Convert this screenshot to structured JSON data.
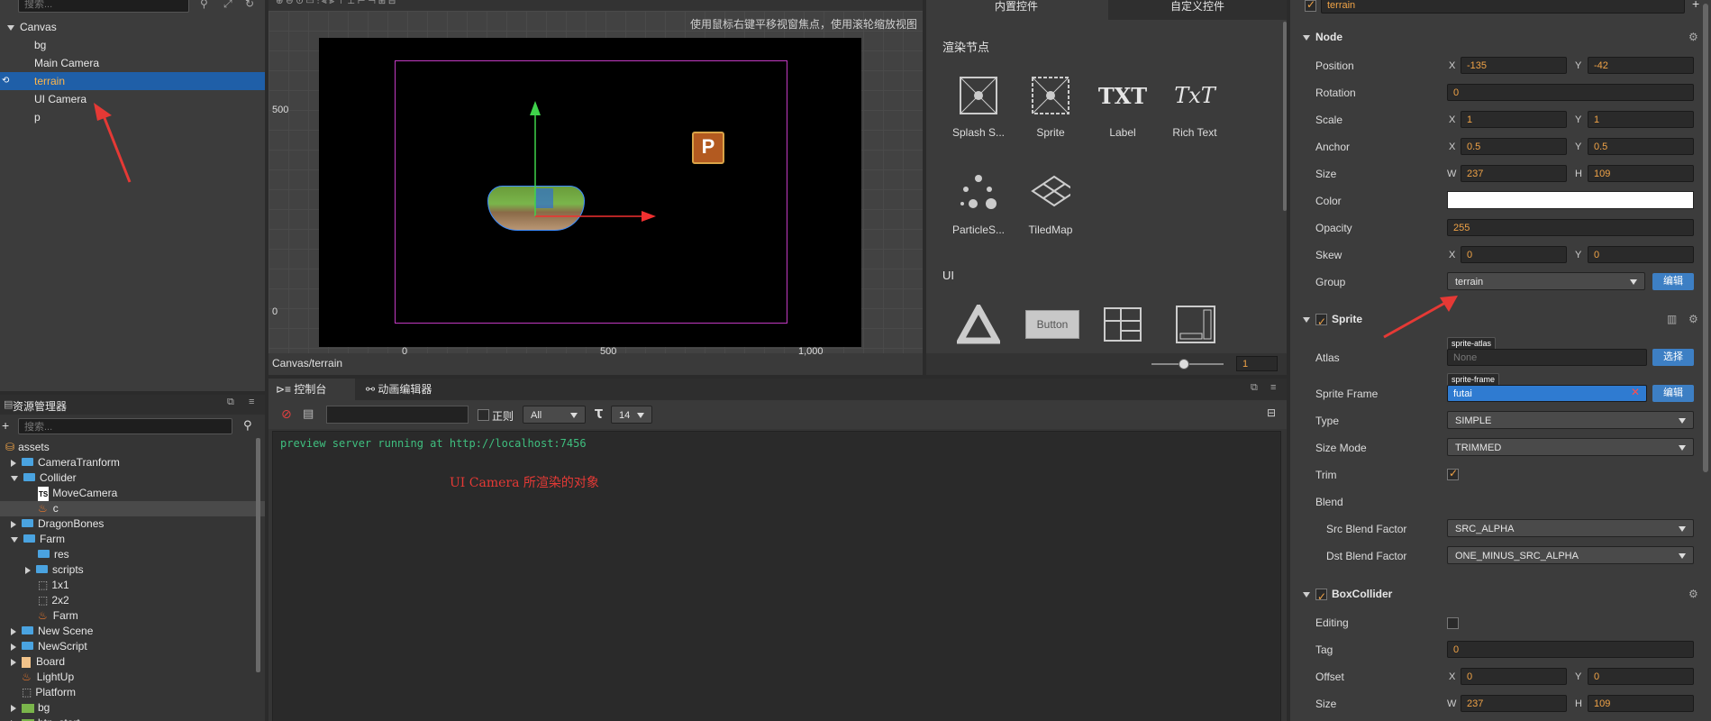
{
  "hierarchy": {
    "search_placeholder": "搜索...",
    "root": "Canvas",
    "items": [
      {
        "label": "bg"
      },
      {
        "label": "Main Camera"
      },
      {
        "label": "terrain"
      },
      {
        "label": "UI Camera"
      },
      {
        "label": "p"
      }
    ]
  },
  "scene": {
    "hint": "使用鼠标右键平移视窗焦点，使用滚轮缩放视图",
    "ruler_y": [
      "500",
      "0"
    ],
    "ruler_x": [
      "0",
      "500",
      "1,000"
    ],
    "breadcrumb": "Canvas/terrain",
    "zoom_value": "1"
  },
  "nodelib": {
    "tabs": [
      "内置控件",
      "自定义控件"
    ],
    "section_render": "渲染节点",
    "render_items": [
      {
        "label": "Splash S...",
        "icon": "splash-icon"
      },
      {
        "label": "Sprite",
        "icon": "sprite-icon"
      },
      {
        "label": "Label",
        "icon": "label-icon",
        "glyph": "TXT"
      },
      {
        "label": "Rich Text",
        "icon": "richtext-icon",
        "glyph": "TxT"
      },
      {
        "label": "ParticleS...",
        "icon": "particle-icon"
      },
      {
        "label": "TiledMap",
        "icon": "tiledmap-icon"
      }
    ],
    "section_ui": "UI",
    "ui_button_label": "Button"
  },
  "assets": {
    "title": "资源管理器",
    "search_placeholder": "搜索...",
    "items": [
      {
        "label": "assets"
      },
      {
        "label": "CameraTranform"
      },
      {
        "label": "Collider"
      },
      {
        "label": "MoveCamera"
      },
      {
        "label": "c"
      },
      {
        "label": "DragonBones"
      },
      {
        "label": "Farm"
      },
      {
        "label": "res"
      },
      {
        "label": "scripts"
      },
      {
        "label": "1x1"
      },
      {
        "label": "2x2"
      },
      {
        "label": "Farm"
      },
      {
        "label": "New Scene"
      },
      {
        "label": "NewScript"
      },
      {
        "label": "Board"
      },
      {
        "label": "LightUp"
      },
      {
        "label": "Platform"
      },
      {
        "label": "bg"
      },
      {
        "label": "btn_start"
      }
    ]
  },
  "console": {
    "tabs": [
      "控制台",
      "动画编辑器"
    ],
    "regex_label": "正则",
    "level_select": "All",
    "font_size": "14",
    "log_line": "preview server running at http://localhost:7456",
    "annotation": "UI Camera 所渲染的对象"
  },
  "inspector": {
    "node_name": "terrain",
    "node_section": "Node",
    "position": {
      "label": "Position",
      "x": "-135",
      "y": "-42"
    },
    "rotation": {
      "label": "Rotation",
      "value": "0"
    },
    "scale": {
      "label": "Scale",
      "x": "1",
      "y": "1"
    },
    "anchor": {
      "label": "Anchor",
      "x": "0.5",
      "y": "0.5"
    },
    "size": {
      "label": "Size",
      "w": "237",
      "h": "109"
    },
    "color": {
      "label": "Color",
      "value": "#ffffff"
    },
    "opacity": {
      "label": "Opacity",
      "value": "255"
    },
    "skew": {
      "label": "Skew",
      "x": "0",
      "y": "0"
    },
    "group": {
      "label": "Group",
      "value": "terrain",
      "edit": "编辑"
    },
    "sprite_section": "Sprite",
    "atlas": {
      "label": "Atlas",
      "tag": "sprite-atlas",
      "placeholder": "None",
      "btn": "选择"
    },
    "sprite_frame": {
      "label": "Sprite Frame",
      "tag": "sprite-frame",
      "value": "futai",
      "btn": "编辑"
    },
    "type": {
      "label": "Type",
      "value": "SIMPLE"
    },
    "size_mode": {
      "label": "Size Mode",
      "value": "TRIMMED"
    },
    "trim": {
      "label": "Trim"
    },
    "blend": {
      "label": "Blend"
    },
    "src_blend": {
      "label": "Src Blend Factor",
      "value": "SRC_ALPHA"
    },
    "dst_blend": {
      "label": "Dst Blend Factor",
      "value": "ONE_MINUS_SRC_ALPHA"
    },
    "box_section": "BoxCollider",
    "editing": {
      "label": "Editing"
    },
    "tag": {
      "label": "Tag",
      "value": "0"
    },
    "offset": {
      "label": "Offset",
      "x": "0",
      "y": "0"
    },
    "box_size": {
      "label": "Size",
      "w": "237",
      "h": "109"
    },
    "axis": {
      "x": "X",
      "y": "Y",
      "w": "W",
      "h": "H"
    }
  },
  "colors": {
    "accent": "#f0a347",
    "selection": "#1f5fa8",
    "annotation_red": "#e53935"
  }
}
